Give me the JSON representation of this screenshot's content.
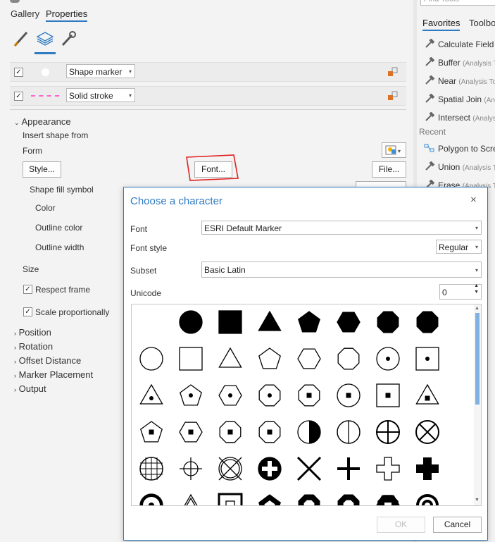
{
  "tabs": [
    "Gallery",
    "Properties"
  ],
  "layers": [
    {
      "checked": true,
      "name": "Shape marker"
    },
    {
      "checked": true,
      "name": "Solid stroke"
    }
  ],
  "appearance": {
    "title": "Appearance",
    "insert_shape_from": "Insert shape from",
    "form": "Form",
    "style_button": "Style...",
    "font_button": "Font...",
    "file_button": "File...",
    "shape_fill_symbol": "Shape fill symbol",
    "color": "Color",
    "outline_color": "Outline color",
    "outline_width": "Outline width",
    "size": "Size",
    "respect_frame": "Respect frame",
    "scale_proportionally": "Scale proportionally"
  },
  "sections": [
    "Position",
    "Rotation",
    "Offset Distance",
    "Marker Placement",
    "Output"
  ],
  "right_panel": {
    "search_placeholder": "Find Tools",
    "tabs": [
      "Favorites",
      "Toolbo"
    ],
    "favorites": [
      {
        "name": "Calculate Field",
        "sub": ""
      },
      {
        "name": "Buffer",
        "sub": "(Analysis T"
      },
      {
        "name": "Near",
        "sub": "(Analysis Too"
      },
      {
        "name": "Spatial Join",
        "sub": "(Analy"
      },
      {
        "name": "Intersect",
        "sub": "(Analys"
      }
    ],
    "recent_label": "Recent",
    "recent": [
      {
        "name": "Polygon to Scre",
        "sub": ""
      },
      {
        "name": "Union",
        "sub": "(Analysis T"
      },
      {
        "name": "Erase",
        "sub": "(Analysis T"
      }
    ]
  },
  "dialog": {
    "title": "Choose a character",
    "font_label": "Font",
    "font_value": "ESRI Default Marker",
    "font_style_label": "Font style",
    "font_style_value": "Regular",
    "subset_label": "Subset",
    "subset_value": "Basic Latin",
    "unicode_label": "Unicode",
    "unicode_value": "0",
    "ok": "OK",
    "cancel": "Cancel"
  },
  "glyphs": [
    [
      "",
      "filled-circle",
      "filled-square",
      "filled-triangle",
      "filled-pentagon",
      "filled-hexagon",
      "filled-octagon",
      "filled-octagon-2"
    ],
    [
      "circle",
      "square",
      "triangle",
      "pentagon",
      "hexagon",
      "octagon",
      "circle-dot",
      "square-dot"
    ],
    [
      "triangle-dot",
      "pentagon-dot",
      "hexagon-dot",
      "octagon-dot",
      "octagon-square",
      "circle-square",
      "square-square",
      "triangle-square"
    ],
    [
      "pentagon-square",
      "hexagon-square",
      "octagon-square-2",
      "octagon-square-3",
      "half-filled-circle",
      "circle-vline",
      "circle-cross",
      "circle-x"
    ],
    [
      "circle-grid",
      "crosshair",
      "circle-x-out",
      "filled-circle-cross",
      "x-mark",
      "plus",
      "outline-plus",
      "filled-plus"
    ],
    [
      "circle-dot-bold",
      "triangle-small",
      "square-inner",
      "pentagon-inner",
      "octagon-inner",
      "octagon-inner-2",
      "hexagon-inner",
      "bullseye"
    ]
  ]
}
